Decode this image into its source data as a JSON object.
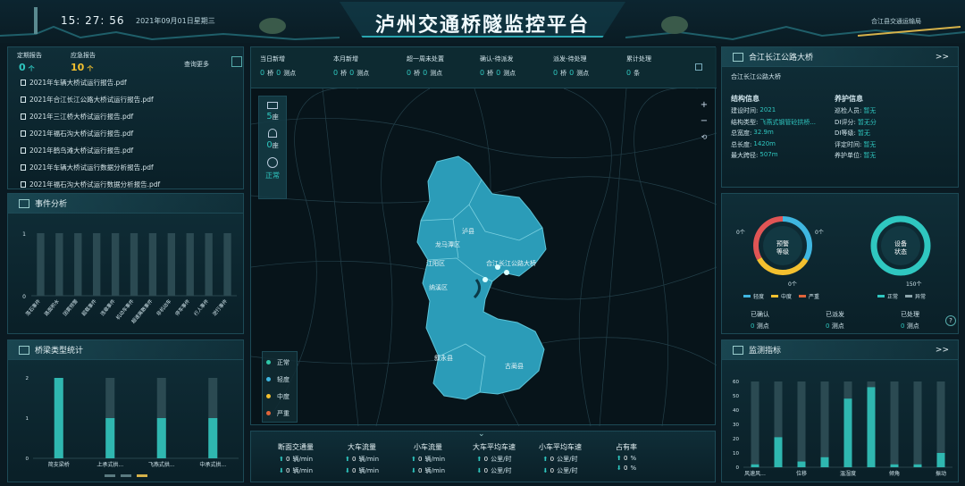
{
  "header": {
    "title": "泸州交通桥隧监控平台",
    "time": "15: 27: 56",
    "date": "2021年09月01日星期三",
    "region": "合江县交通运输局"
  },
  "reports": {
    "regular_label": "定期报告",
    "regular_value": "0",
    "emergency_label": "应急报告",
    "emergency_value": "10",
    "unit": "个",
    "query_more": "查询更多",
    "items": [
      "2021年车辆大桥试运行报告.pdf",
      "2021年合江长江公路大桥试运行报告.pdf",
      "2021年三江桥大桥试运行报告.pdf",
      "2021年福石沟大桥试运行报告.pdf",
      "2021年鹤鸟滩大桥试运行报告.pdf",
      "2021年车辆大桥试运行数据分析报告.pdf",
      "2021年福石沟大桥试运行数据分析报告.pdf"
    ]
  },
  "event_analysis": {
    "title": "事件分析",
    "y_ticks": [
      "1",
      "0"
    ],
    "categories": [
      "落石事件",
      "路面积水",
      "团雾预警",
      "超载事件",
      "违章事件",
      "机动车事件",
      "超速离散事件",
      "非机动车",
      "停车事件",
      "行人事件",
      "逆行事件"
    ]
  },
  "bridge_stats": {
    "title": "桥梁类型统计",
    "chart_data": {
      "type": "bar",
      "categories": [
        "简支梁桥",
        "上承式拱...",
        "飞燕式拱...",
        "中承式拱..."
      ],
      "values": [
        2,
        1,
        1,
        1
      ],
      "ylim": [
        0,
        2
      ],
      "y_ticks": [
        "2",
        "1",
        "0"
      ]
    }
  },
  "top_stats": [
    {
      "label": "当日新增",
      "a": "0",
      "au": "桥",
      "b": "0",
      "bu": "测点"
    },
    {
      "label": "本月新增",
      "a": "0",
      "au": "桥",
      "b": "0",
      "bu": "测点"
    },
    {
      "label": "超一周未处置",
      "a": "0",
      "au": "桥",
      "b": "0",
      "bu": "测点"
    },
    {
      "label": "确认-待派发",
      "a": "0",
      "au": "桥",
      "b": "0",
      "bu": "测点"
    },
    {
      "label": "派发-待处理",
      "a": "0",
      "au": "桥",
      "b": "0",
      "bu": "测点"
    },
    {
      "label": "累计处理",
      "a": "0",
      "au": "条",
      "b": "",
      "bu": ""
    }
  ],
  "map": {
    "bridge_count": "5",
    "tunnel_count": "0",
    "count_unit": "座",
    "status_label": "正常",
    "places": [
      "泸县",
      "龙马潭区",
      "江阳区",
      "纳溪区",
      "合江长江公路大桥",
      "叙永县",
      "古蔺县"
    ],
    "legend": [
      {
        "label": "正常",
        "color": "#2fc7a8"
      },
      {
        "label": "轻度",
        "color": "#3fb6e0"
      },
      {
        "label": "中度",
        "color": "#f3c02f"
      },
      {
        "label": "严重",
        "color": "#e0643a"
      }
    ]
  },
  "traffic": [
    {
      "label": "断面交通量",
      "r1": "0",
      "r2": "0",
      "unit": "辆/min"
    },
    {
      "label": "大车流量",
      "r1": "0",
      "r2": "0",
      "unit": "辆/min"
    },
    {
      "label": "小车流量",
      "r1": "0",
      "r2": "0",
      "unit": "辆/min"
    },
    {
      "label": "大车平均车速",
      "r1": "0",
      "r2": "0",
      "unit": "公里/时"
    },
    {
      "label": "小车平均车速",
      "r1": "0",
      "r2": "0",
      "unit": "公里/时"
    },
    {
      "label": "占有率",
      "r1": "0",
      "r2": "0",
      "unit": "%"
    }
  ],
  "bridge_info": {
    "title": "合江长江公路大桥",
    "subtitle": "合江长江公路大桥",
    "more": ">>",
    "structure_title": "结构信息",
    "maintenance_title": "养护信息",
    "structure": [
      {
        "k": "建设时间:",
        "v": "2021"
      },
      {
        "k": "结构类型:",
        "v": "飞燕式钢管砼拱桥..."
      },
      {
        "k": "总宽度:",
        "v": "32.9m"
      },
      {
        "k": "总长度:",
        "v": "1420m"
      },
      {
        "k": "最大跨径:",
        "v": "507m"
      }
    ],
    "maintenance": [
      {
        "k": "巡检人员:",
        "v": "暂无"
      },
      {
        "k": "DI评分:",
        "v": "暂无分"
      },
      {
        "k": "DI等级:",
        "v": "暂无"
      },
      {
        "k": "评定时间:",
        "v": "暂无"
      },
      {
        "k": "养护单位:",
        "v": "暂无"
      }
    ]
  },
  "alerts": {
    "donut1_label_1": "预警",
    "donut1_label_2": "等级",
    "donut2_label_1": "设备",
    "donut2_label_2": "状态",
    "donut1_top": "0个",
    "donut1_right": "0个",
    "donut1_bottom": "0个",
    "donut2_bottom": "150个",
    "legend1": [
      {
        "label": "轻度",
        "color": "#3fb6e0"
      },
      {
        "label": "中度",
        "color": "#f3c02f"
      },
      {
        "label": "严重",
        "color": "#e0643a"
      }
    ],
    "legend2": [
      {
        "label": "正常",
        "color": "#2fc7c0"
      },
      {
        "label": "异常",
        "color": "#8ea7ad"
      }
    ],
    "confirmed_label": "已确认",
    "dispatched_label": "已派发",
    "handled_label": "已处理",
    "confirmed": "0",
    "dispatched": "0",
    "handled": "0",
    "unit": "测点"
  },
  "monitoring": {
    "title": "监测指标",
    "more": ">>",
    "chart_data": {
      "type": "bar",
      "categories": [
        "风速风...",
        "",
        "位移",
        "",
        "温湿度",
        "",
        "倾角",
        "",
        "振动"
      ],
      "values": [
        2,
        21,
        4,
        7,
        48,
        56,
        2,
        2,
        10
      ],
      "ylim": [
        0,
        60
      ],
      "y_ticks": [
        "60",
        "50",
        "40",
        "30",
        "20",
        "10",
        "0"
      ]
    }
  }
}
